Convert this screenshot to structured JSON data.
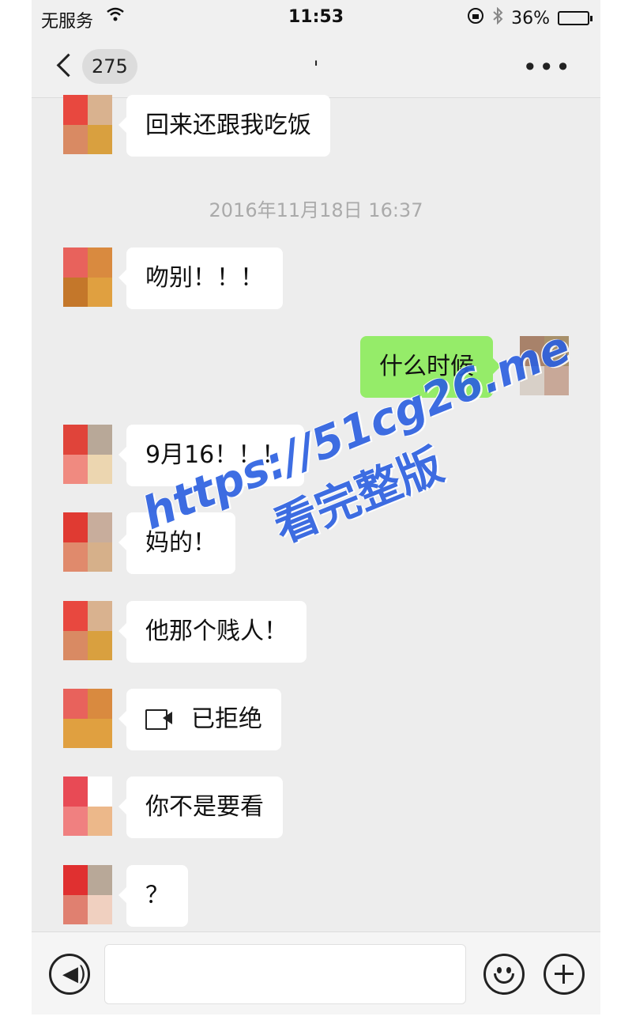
{
  "status_bar": {
    "carrier": "无服务",
    "time": "11:53",
    "battery": "36%",
    "battery_level": 0.36
  },
  "header": {
    "unread_count": "275",
    "title": "'"
  },
  "timestamp": "2016年11月18日 16:37",
  "messages": [
    {
      "side": "left",
      "text": "回来还跟我吃饭",
      "avatar_colors": [
        "#e8483f",
        "#d9b28f",
        "#d98a63",
        "#d9a03f"
      ]
    },
    {
      "side": "left",
      "text": "吻别！！！",
      "avatar_colors": [
        "#e8625c",
        "#d98a3f",
        "#c4772a",
        "#e0a040"
      ]
    },
    {
      "side": "right",
      "text": "什么时候",
      "avatar_colors": [
        "#a8826a",
        "#a8906a",
        "#d8d0c8",
        "#c8a898"
      ]
    },
    {
      "side": "left",
      "text": "9月16！！！",
      "avatar_colors": [
        "#e0443a",
        "#b8a898",
        "#f08a80",
        "#ecd6b0"
      ]
    },
    {
      "side": "left",
      "text": "妈的！",
      "avatar_colors": [
        "#e03a32",
        "#c8ad9c",
        "#e08a6c",
        "#d6b08a"
      ]
    },
    {
      "side": "left",
      "text": "他那个贱人！",
      "avatar_colors": [
        "#e8483f",
        "#d9b28f",
        "#d98a63",
        "#d9a03f"
      ]
    },
    {
      "side": "left",
      "text": "已拒绝",
      "icon": "video-call-icon",
      "avatar_colors": [
        "#e8625c",
        "#d98a3f",
        "#e0a040",
        "#e0a040"
      ]
    },
    {
      "side": "left",
      "text": "你不是要看",
      "avatar_colors": [
        "#e84a55",
        "#ffffff",
        "#f08080",
        "#ecb88a"
      ]
    },
    {
      "side": "left",
      "text": "？",
      "avatar_colors": [
        "#e03030",
        "#b8a898",
        "#e08070",
        "#f0d0c0"
      ]
    }
  ],
  "watermark": {
    "url": "https://51cg26.me",
    "caption": "看完整版"
  },
  "input_bar": {
    "voice_icon": "voice-icon",
    "emoji_icon": "emoji-icon",
    "plus_icon": "plus-icon"
  }
}
